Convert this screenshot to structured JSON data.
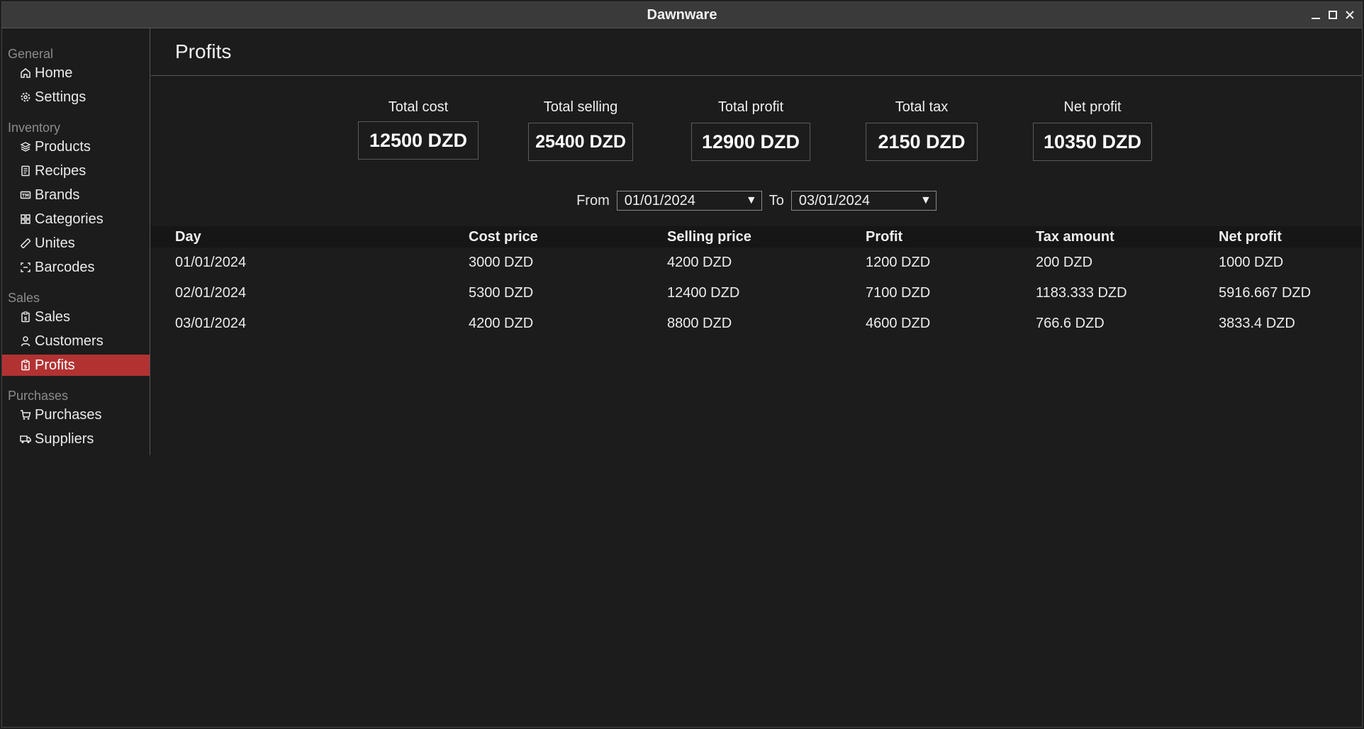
{
  "window": {
    "title": "Dawnware",
    "controls": [
      "minimize-icon",
      "maximize-icon",
      "close-icon"
    ]
  },
  "sidebar": {
    "sections": [
      {
        "label": "General",
        "items": [
          {
            "label": "Home",
            "icon": "home-icon"
          },
          {
            "label": "Settings",
            "icon": "gear-icon"
          }
        ]
      },
      {
        "label": "Inventory",
        "items": [
          {
            "label": "Products",
            "icon": "layers-icon"
          },
          {
            "label": "Recipes",
            "icon": "receipt-icon"
          },
          {
            "label": "Brands",
            "icon": "tag-icon"
          },
          {
            "label": "Categories",
            "icon": "grid-icon"
          },
          {
            "label": "Unites",
            "icon": "ruler-icon"
          },
          {
            "label": "Barcodes",
            "icon": "barcode-icon"
          }
        ]
      },
      {
        "label": "Sales",
        "items": [
          {
            "label": "Sales",
            "icon": "clipboard-dollar-icon"
          },
          {
            "label": "Customers",
            "icon": "user-icon"
          },
          {
            "label": "Profits",
            "icon": "clipboard-dollar-icon",
            "active": true
          }
        ]
      },
      {
        "label": "Purchases",
        "items": [
          {
            "label": "Purchases",
            "icon": "cart-icon"
          },
          {
            "label": "Suppliers",
            "icon": "truck-icon"
          }
        ]
      }
    ],
    "active_color": "#b23232"
  },
  "page": {
    "title": "Profits"
  },
  "stats": [
    {
      "label": "Total cost",
      "value": "12500 DZD"
    },
    {
      "label": "Total selling",
      "value": "25400 DZD"
    },
    {
      "label": "Total profit",
      "value": "12900 DZD"
    },
    {
      "label": "Total tax",
      "value": "2150 DZD"
    },
    {
      "label": "Net profit",
      "value": "10350 DZD"
    }
  ],
  "filters": {
    "from_label": "From",
    "from_value": "01/01/2024",
    "to_label": "To",
    "to_value": "03/01/2024"
  },
  "table": {
    "columns": [
      "Day",
      "Cost price",
      "Selling price",
      "Profit",
      "Tax amount",
      "Net profit"
    ],
    "rows": [
      [
        "01/01/2024",
        "3000 DZD",
        "4200 DZD",
        "1200 DZD",
        "200 DZD",
        "1000 DZD"
      ],
      [
        "02/01/2024",
        "5300 DZD",
        "12400 DZD",
        "7100 DZD",
        "1183.333 DZD",
        "5916.667 DZD"
      ],
      [
        "03/01/2024",
        "4200 DZD",
        "8800 DZD",
        "4600 DZD",
        "766.6 DZD",
        "3833.4 DZD"
      ]
    ]
  }
}
